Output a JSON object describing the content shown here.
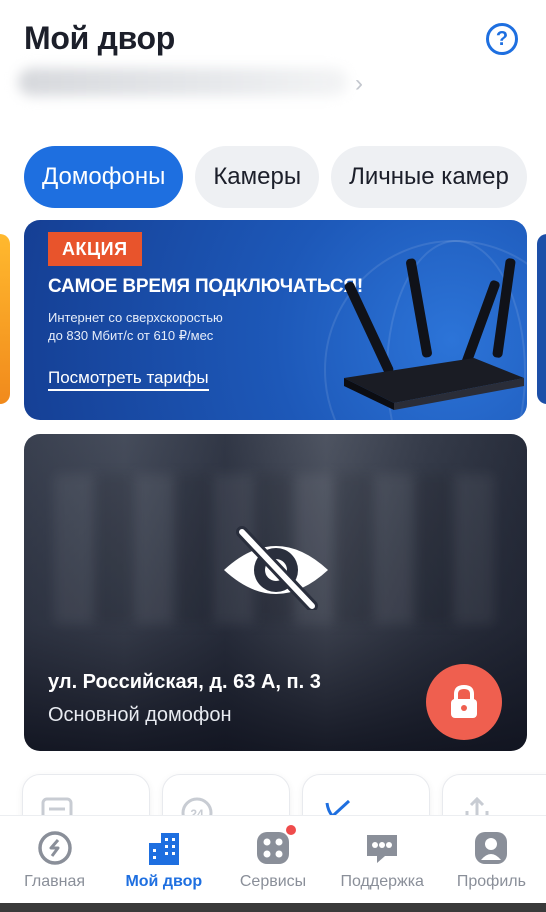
{
  "header": {
    "title": "Мой двор",
    "help_icon": "question-circle-icon"
  },
  "tabs": [
    {
      "label": "Домофоны",
      "active": true
    },
    {
      "label": "Камеры",
      "active": false
    },
    {
      "label": "Личные камер",
      "active": false
    }
  ],
  "promo": {
    "badge": "АКЦИЯ",
    "headline": "САМОЕ ВРЕМЯ ПОДКЛЮЧАТЬСЯ!",
    "line1": "Интернет со сверхскоростью",
    "line2": "до 830 Мбит/с от 610 ₽/мес",
    "link": "Посмотреть тарифы"
  },
  "camera": {
    "address": "ул. Российская, д. 63 А, п. 3",
    "label": "Основной домофон",
    "status_icon": "eye-off-icon",
    "action_icon": "lock-icon"
  },
  "bottom_nav": [
    {
      "label": "Главная",
      "icon": "home-logo-icon",
      "active": false
    },
    {
      "label": "Мой двор",
      "icon": "building-icon",
      "active": true
    },
    {
      "label": "Сервисы",
      "icon": "grid-dots-icon",
      "active": false,
      "badge": true
    },
    {
      "label": "Поддержка",
      "icon": "chat-bubble-icon",
      "active": false
    },
    {
      "label": "Профиль",
      "icon": "profile-icon",
      "active": false
    }
  ],
  "colors": {
    "accent": "#1e6fe0",
    "promo_badge": "#e8542c",
    "lock_button": "#ef5f4f",
    "notification_dot": "#ef4b4b"
  }
}
